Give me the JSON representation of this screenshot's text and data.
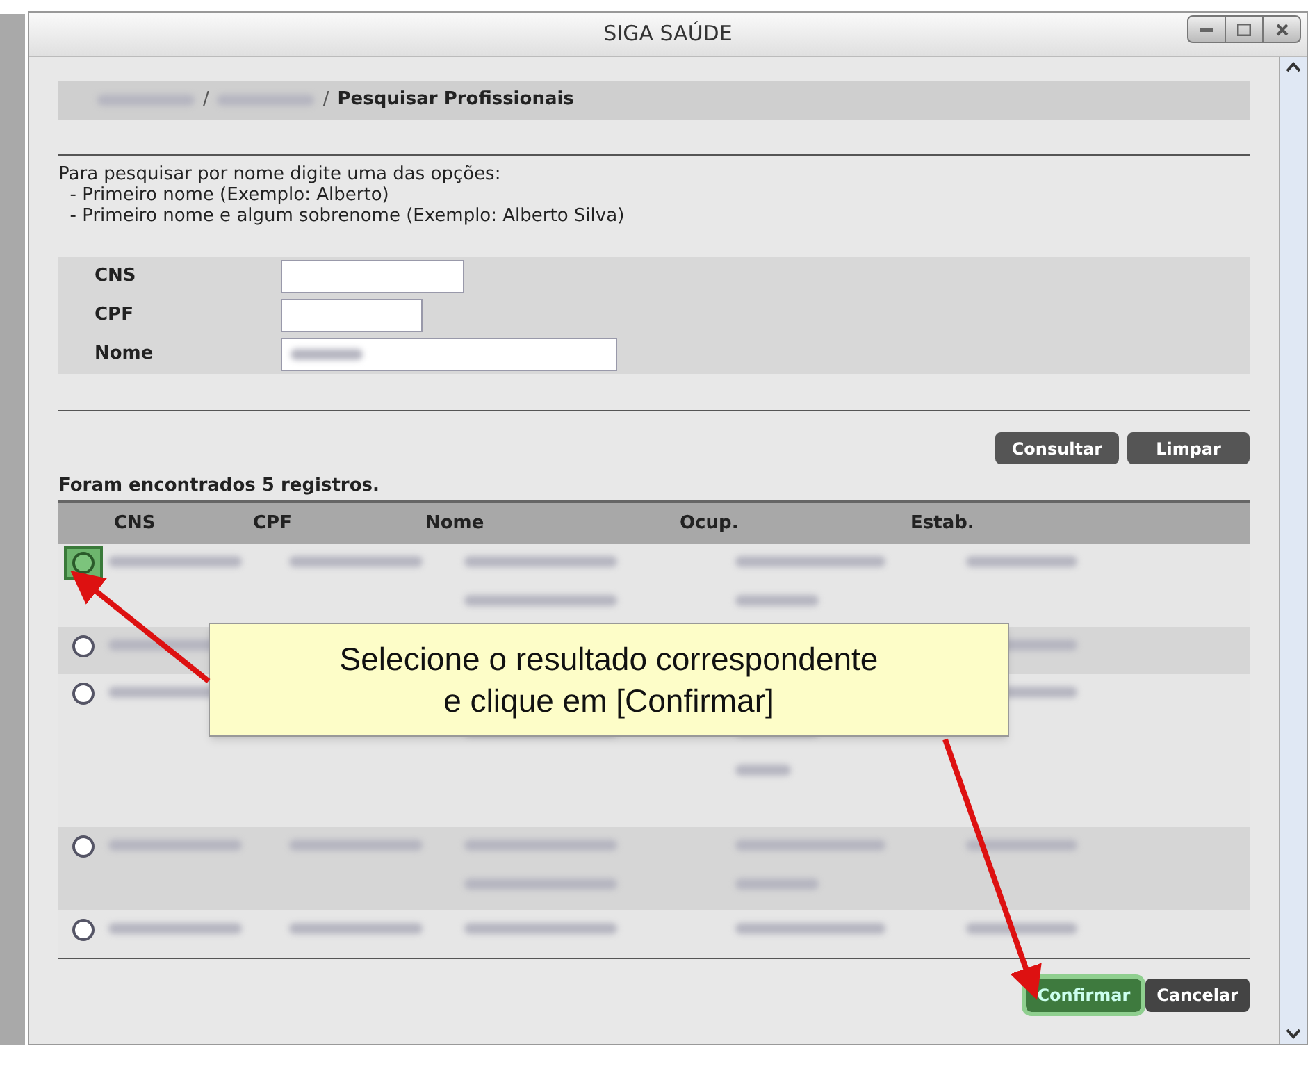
{
  "window": {
    "title": "SIGA SAÚDE"
  },
  "breadcrumb": {
    "separators": [
      "/",
      "/"
    ],
    "current": "Pesquisar Profissionais"
  },
  "instructions": [
    "Para pesquisar por nome digite uma das opções:",
    "  - Primeiro nome (Exemplo: Alberto)",
    "  - Primeiro nome e algum sobrenome (Exemplo: Alberto Silva)"
  ],
  "form": {
    "fields": [
      {
        "label": "CNS",
        "kind": "empty"
      },
      {
        "label": "CPF",
        "kind": "empty"
      },
      {
        "label": "Nome",
        "kind": "redacted"
      }
    ]
  },
  "actions": [
    "Consultar",
    "Limpar"
  ],
  "result_count": "Foram encontrados 5 registros.",
  "table": {
    "columns": [
      "CNS",
      "CPF",
      "Nome",
      "Ocup.",
      "Estab."
    ],
    "rows": [
      {
        "kind": "two_line",
        "selected": false,
        "highlighted": true
      },
      {
        "kind": "one_line",
        "selected": false,
        "highlighted": false
      },
      {
        "kind": "three_line",
        "selected": false,
        "highlighted": false
      },
      {
        "kind": "two_line",
        "selected": false,
        "highlighted": false
      },
      {
        "kind": "one_line",
        "selected": false,
        "highlighted": false
      }
    ]
  },
  "footer_buttons": [
    {
      "label": "Confirmar",
      "highlighted": true
    },
    {
      "label": "Cancelar",
      "highlighted": false
    }
  ],
  "callout": {
    "lines": [
      "Selecione o resultado correspondente",
      "e clique em [Confirmar]"
    ]
  }
}
